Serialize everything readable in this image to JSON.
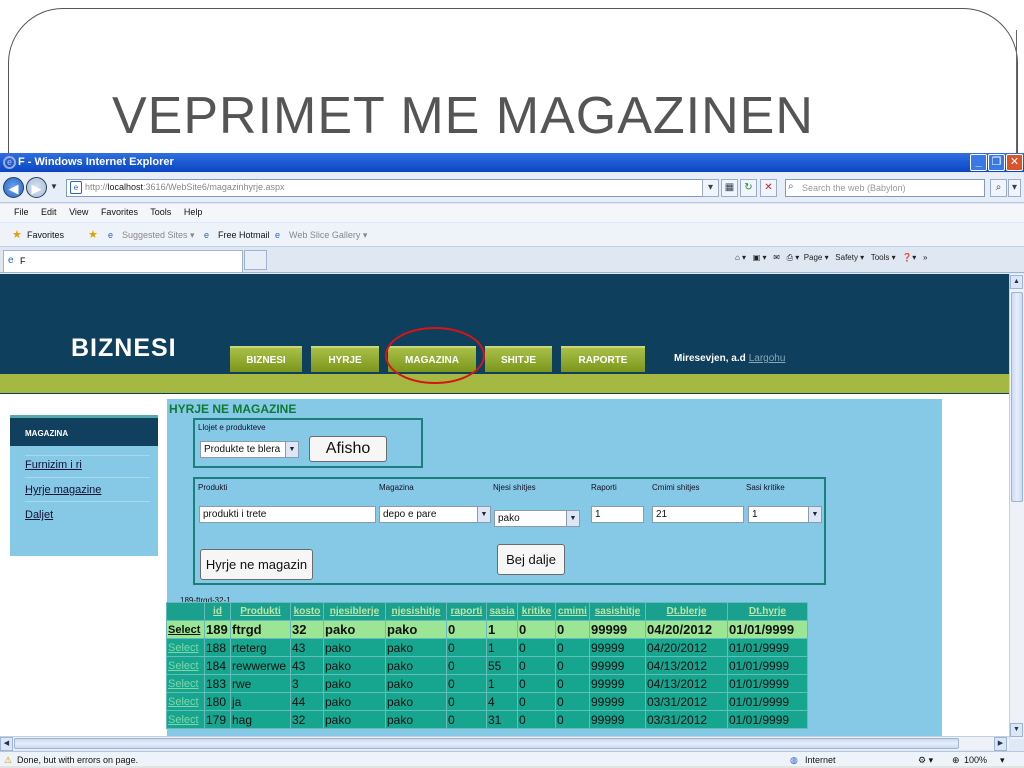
{
  "slide": {
    "title": "VEPRIMET ME MAGAZINEN"
  },
  "browser": {
    "window_title": "F - Windows Internet Explorer",
    "address_prefix": "http://",
    "address_host": "localhost",
    "address_rest": ":3616/WebSite6/magazinhyrje.aspx",
    "search_placeholder": "Search the web (Babylon)",
    "menu": [
      "File",
      "Edit",
      "View",
      "Favorites",
      "Tools",
      "Help"
    ],
    "favorites_label": "Favorites",
    "suggested_sites": "Suggested Sites ▾",
    "free_hotmail": "Free Hotmail",
    "web_slice": "Web Slice Gallery ▾",
    "tab_title": "F",
    "cmd_page": "Page ▾",
    "cmd_safety": "Safety ▾",
    "cmd_tools": "Tools ▾",
    "status_text": "Done, but with errors on page.",
    "zone": "Internet",
    "zoom": "100%"
  },
  "site": {
    "brand": "BIZNESI",
    "nav": [
      "BIZNESI",
      "HYRJE",
      "MAGAZINA",
      "SHITJE",
      "RAPORTE"
    ],
    "greeting": "Miresevjen, a.d",
    "logout": "Largohu",
    "sidebar": {
      "heading": "MAGAZINA",
      "items": [
        "Furnizim i ri",
        "Hyrje magazine",
        "Daljet"
      ]
    }
  },
  "form": {
    "title": "HYRJE NE MAGAZINE",
    "product_type_label": "Llojet e produkteve",
    "product_type_value": "Produkte te blera",
    "show_button": "Afisho",
    "labels": {
      "product": "Produkti",
      "warehouse": "Magazina",
      "sale_unit": "Njesi shitjes",
      "ratio": "Raporti",
      "sale_price": "Cmimi shitjes",
      "critical_qty": "Sasi kritike"
    },
    "values": {
      "product": "produkti i trete",
      "warehouse": "depo e pare",
      "sale_unit": "pako",
      "ratio": "1",
      "sale_price": "21",
      "critical_qty": "1"
    },
    "enter_button": "Hyrje ne magazin",
    "exit_button": "Bej dalje",
    "code": "189-ftrgd-32-1"
  },
  "grid": {
    "headers": [
      "",
      "id",
      "Produkti",
      "kosto",
      "njesiblerje",
      "njesishitje",
      "raporti",
      "sasia",
      "kritike",
      "cmimi",
      "sasishitje",
      "Dt.blerje",
      "Dt.hyrje"
    ],
    "select_label": "Select",
    "rows": [
      [
        "Select",
        "189",
        "ftrgd",
        "32",
        "pako",
        "pako",
        "0",
        "1",
        "0",
        "0",
        "99999",
        "04/20/2012",
        "01/01/9999"
      ],
      [
        "Select",
        "188",
        "rteterg",
        "43",
        "pako",
        "pako",
        "0",
        "1",
        "0",
        "0",
        "99999",
        "04/20/2012",
        "01/01/9999"
      ],
      [
        "Select",
        "184",
        "rewwerwe",
        "43",
        "pako",
        "pako",
        "0",
        "55",
        "0",
        "0",
        "99999",
        "04/13/2012",
        "01/01/9999"
      ],
      [
        "Select",
        "183",
        "rwe",
        "3",
        "pako",
        "pako",
        "0",
        "1",
        "0",
        "0",
        "99999",
        "04/13/2012",
        "01/01/9999"
      ],
      [
        "Select",
        "180",
        "ja",
        "44",
        "pako",
        "pako",
        "0",
        "4",
        "0",
        "0",
        "99999",
        "03/31/2012",
        "01/01/9999"
      ],
      [
        "Select",
        "179",
        "hag",
        "32",
        "pako",
        "pako",
        "0",
        "31",
        "0",
        "0",
        "99999",
        "03/31/2012",
        "01/01/9999"
      ]
    ]
  },
  "colors": {
    "header_bg": "#0e3f5c",
    "nav_green": "#92ad2e",
    "panel_blue": "#86c9e6",
    "grid_teal": "#16a58f",
    "selected_row": "#9be695",
    "annotation_red": "#d51616"
  }
}
